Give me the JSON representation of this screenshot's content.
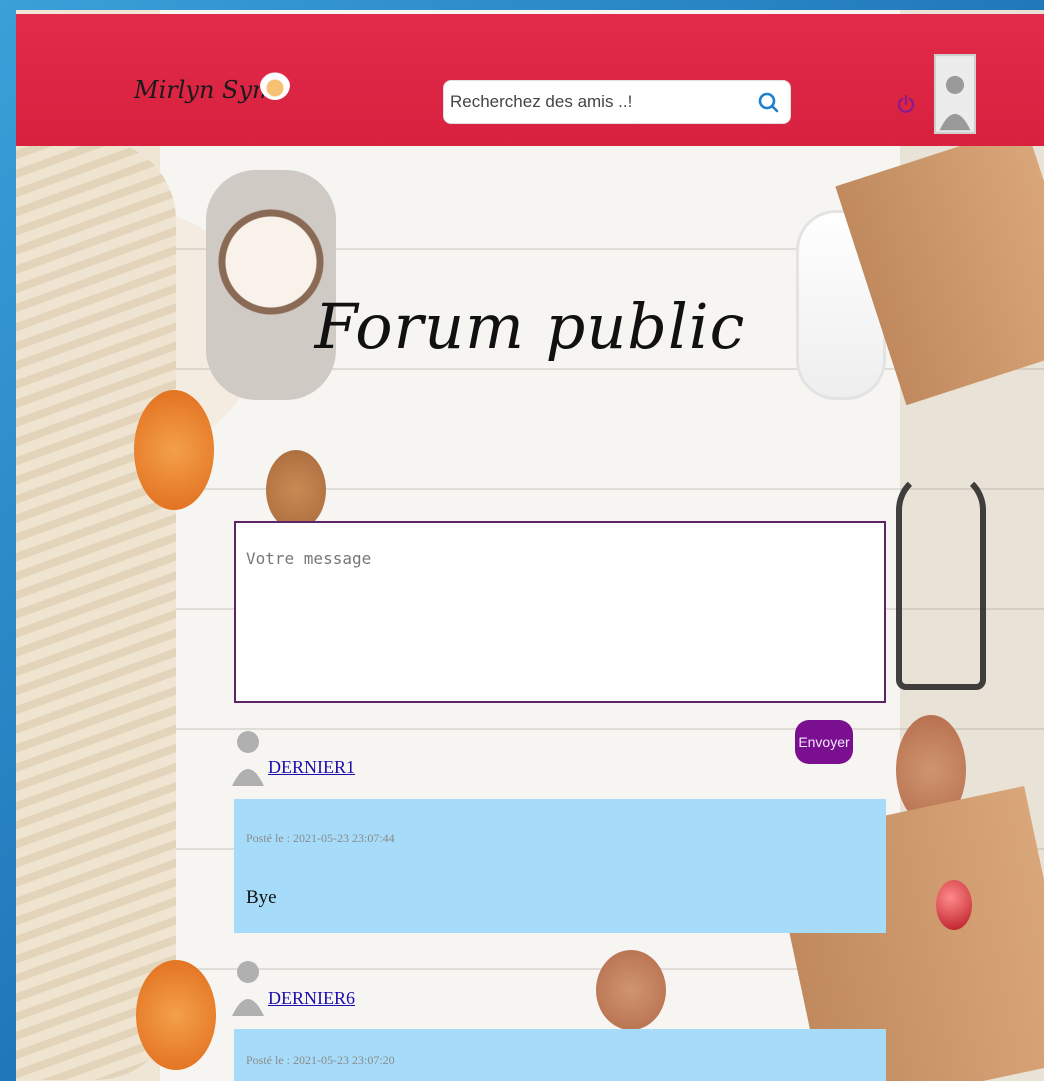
{
  "header": {
    "logo_text": "Mirlyn Sym",
    "search_placeholder": "Recherchez des amis ..!",
    "search_value": "",
    "icons": [
      "search-icon",
      "power-icon",
      "avatar"
    ]
  },
  "main": {
    "title": "Forum public",
    "message_placeholder": "Votre message",
    "message_value": "",
    "send_label": "Envoyer"
  },
  "posts": [
    {
      "author": "DERNIER1",
      "date": "Posté le : 2021-05-23 23:07:44",
      "body": "Bye"
    },
    {
      "author": "DERNIER6",
      "date": "Posté le : 2021-05-23 23:07:20",
      "body": ""
    }
  ],
  "colors": {
    "header": "#d8213f",
    "send_button": "#7a0f90",
    "post_card": "#a6dcf9",
    "textarea_border": "#5e2466"
  }
}
